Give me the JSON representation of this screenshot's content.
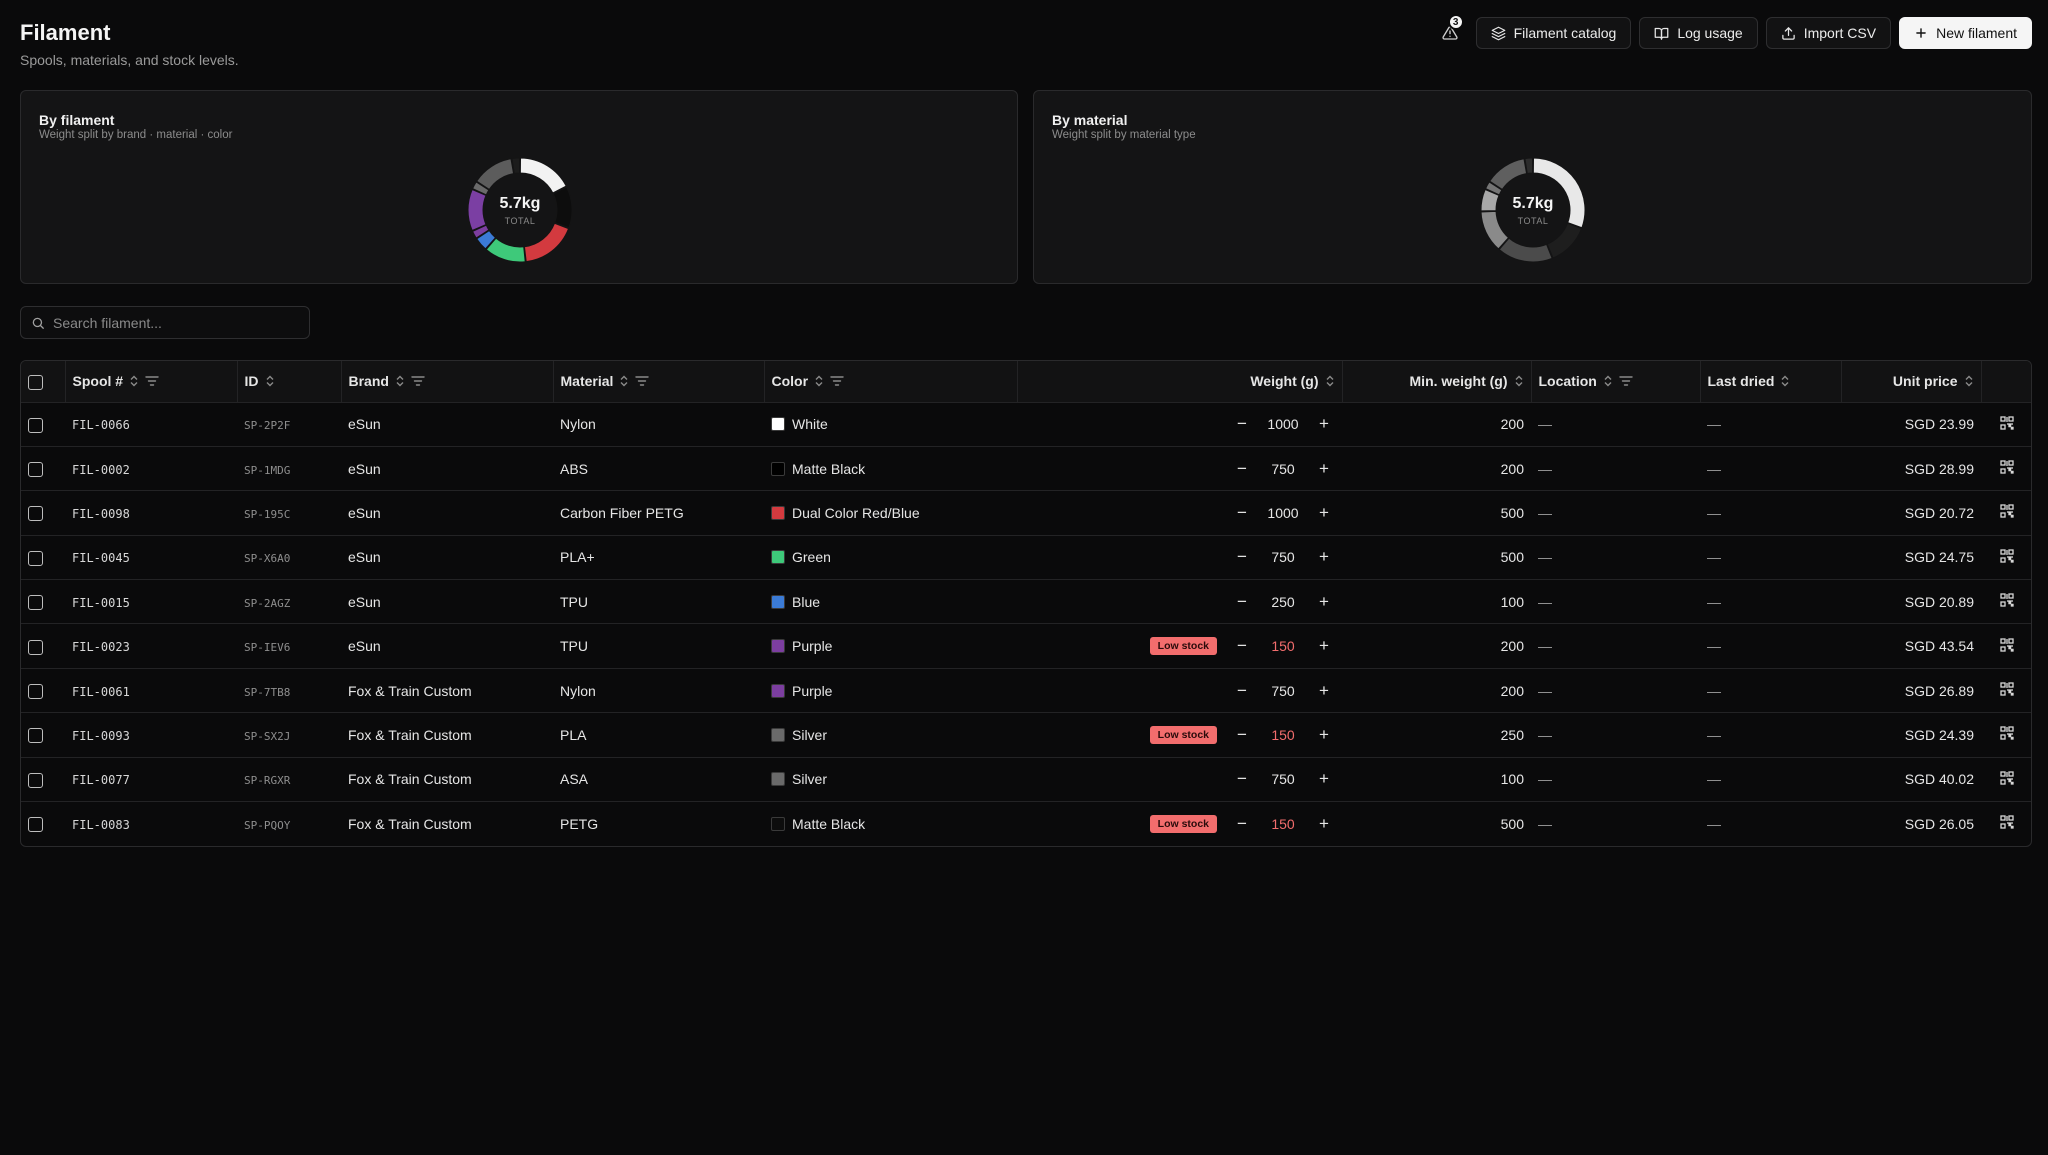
{
  "header": {
    "title": "Filament",
    "subtitle": "Spools, materials, and stock levels."
  },
  "toolbar": {
    "alert_count": "3",
    "catalog_label": "Filament catalog",
    "log_usage_label": "Log usage",
    "import_label": "Import CSV",
    "new_label": "New filament"
  },
  "cards": {
    "by_filament": {
      "title": "By filament",
      "subtitle": "Weight split by brand · material · color",
      "total": "5.7kg",
      "caption": "TOTAL"
    },
    "by_material": {
      "title": "By material",
      "subtitle": "Weight split by material type",
      "total": "5.7kg",
      "caption": "TOTAL"
    }
  },
  "chart_data": [
    {
      "type": "pie",
      "chart": "by_filament",
      "categories": [
        "eSun Nylon White",
        "eSun ABS Matte Black",
        "eSun Carbon Fiber PETG Dual Color Red/Blue",
        "eSun PLA+ Green",
        "eSun TPU Blue",
        "eSun TPU Purple",
        "Fox & Train Custom Nylon Purple",
        "Fox & Train Custom PLA Silver",
        "Fox & Train Custom ASA Silver",
        "Fox & Train Custom PETG Matte Black"
      ],
      "values": [
        1000,
        750,
        1000,
        750,
        250,
        150,
        750,
        150,
        750,
        150
      ],
      "colors": [
        "#f2f2f2",
        "#0d0d0d",
        "#d33a3f",
        "#3ec97a",
        "#3b7bd6",
        "#7c3ea0",
        "#7b3fa3",
        "#6a6a6a",
        "#5c5c5c",
        "#1c1c1c"
      ]
    },
    {
      "type": "pie",
      "chart": "by_material",
      "categories": [
        "Nylon",
        "ABS",
        "Carbon Fiber PETG",
        "PLA+",
        "TPU",
        "PLA",
        "ASA",
        "PETG"
      ],
      "values": [
        1750,
        750,
        1000,
        750,
        400,
        150,
        750,
        150
      ],
      "colors": [
        "#e8e8e8",
        "#1e1e1e",
        "#4b4b4b",
        "#8a8a8a",
        "#a8a8a8",
        "#757575",
        "#5f5f5f",
        "#2c2c2c"
      ]
    }
  ],
  "search": {
    "placeholder": "Search filament..."
  },
  "table": {
    "columns": {
      "spool": "Spool #",
      "id": "ID",
      "brand": "Brand",
      "material": "Material",
      "color": "Color",
      "weight": "Weight (g)",
      "min_weight": "Min. weight (g)",
      "location": "Location",
      "last_dried": "Last dried",
      "unit_price": "Unit price"
    },
    "low_stock_label": "Low stock",
    "rows": [
      {
        "spool": "FIL-0066",
        "id": "SP-2P2F",
        "brand": "eSun",
        "material": "Nylon",
        "color": "White",
        "swatch": "#ffffff",
        "weight": "1000",
        "low": false,
        "min": "200",
        "location": "—",
        "dried": "—",
        "price": "SGD 23.99"
      },
      {
        "spool": "FIL-0002",
        "id": "SP-1MDG",
        "brand": "eSun",
        "material": "ABS",
        "color": "Matte Black",
        "swatch": "#000000",
        "weight": "750",
        "low": false,
        "min": "200",
        "location": "—",
        "dried": "—",
        "price": "SGD 28.99"
      },
      {
        "spool": "FIL-0098",
        "id": "SP-195C",
        "brand": "eSun",
        "material": "Carbon Fiber PETG",
        "color": "Dual Color Red/Blue",
        "swatch": "#d33a3f",
        "weight": "1000",
        "low": false,
        "min": "500",
        "location": "—",
        "dried": "—",
        "price": "SGD 20.72"
      },
      {
        "spool": "FIL-0045",
        "id": "SP-X6A0",
        "brand": "eSun",
        "material": "PLA+",
        "color": "Green",
        "swatch": "#3ec97a",
        "weight": "750",
        "low": false,
        "min": "500",
        "location": "—",
        "dried": "—",
        "price": "SGD 24.75"
      },
      {
        "spool": "FIL-0015",
        "id": "SP-2AGZ",
        "brand": "eSun",
        "material": "TPU",
        "color": "Blue",
        "swatch": "#3b7bd6",
        "weight": "250",
        "low": false,
        "min": "100",
        "location": "—",
        "dried": "—",
        "price": "SGD 20.89"
      },
      {
        "spool": "FIL-0023",
        "id": "SP-IEV6",
        "brand": "eSun",
        "material": "TPU",
        "color": "Purple",
        "swatch": "#7c3ea0",
        "weight": "150",
        "low": true,
        "min": "200",
        "location": "—",
        "dried": "—",
        "price": "SGD 43.54"
      },
      {
        "spool": "FIL-0061",
        "id": "SP-7TB8",
        "brand": "Fox & Train Custom",
        "material": "Nylon",
        "color": "Purple",
        "swatch": "#7c3ea0",
        "weight": "750",
        "low": false,
        "min": "200",
        "location": "—",
        "dried": "—",
        "price": "SGD 26.89"
      },
      {
        "spool": "FIL-0093",
        "id": "SP-SX2J",
        "brand": "Fox & Train Custom",
        "material": "PLA",
        "color": "Silver",
        "swatch": "#6a6a6a",
        "weight": "150",
        "low": true,
        "min": "250",
        "location": "—",
        "dried": "—",
        "price": "SGD 24.39"
      },
      {
        "spool": "FIL-0077",
        "id": "SP-RGXR",
        "brand": "Fox & Train Custom",
        "material": "ASA",
        "color": "Silver",
        "swatch": "#6a6a6a",
        "weight": "750",
        "low": false,
        "min": "100",
        "location": "—",
        "dried": "—",
        "price": "SGD 40.02"
      },
      {
        "spool": "FIL-0083",
        "id": "SP-PQOY",
        "brand": "Fox & Train Custom",
        "material": "PETG",
        "color": "Matte Black",
        "swatch": "#0d0d0d",
        "weight": "150",
        "low": true,
        "min": "500",
        "location": "—",
        "dried": "—",
        "price": "SGD 26.05"
      }
    ]
  }
}
